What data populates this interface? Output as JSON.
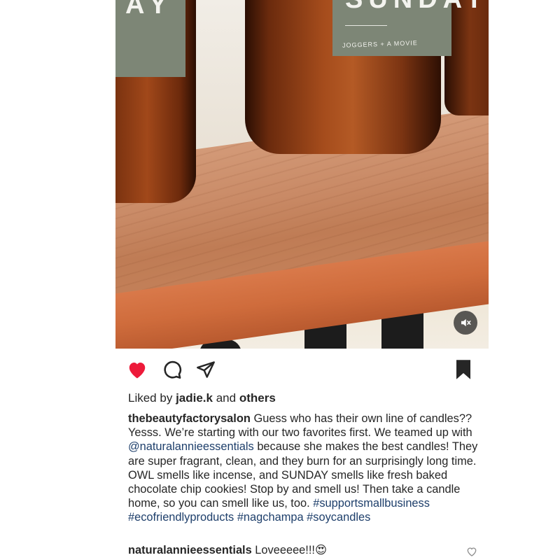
{
  "post": {
    "media": {
      "jar_left_label": "AY",
      "jar_mid_label": "SUNDAY",
      "jar_mid_sublabel": "JOGGERS + A MOVIE",
      "muted": true
    },
    "actions": {
      "liked": true,
      "saved": true,
      "like_color": "#ed1a3a"
    },
    "likes": {
      "prefix": "Liked by",
      "user": "jadie.k",
      "middle": "and",
      "others": "others"
    },
    "caption": {
      "user": "thebeautyfactorysalon",
      "text_1": "Guess who has their own line of candles?? Yesss.  We’re starting with our two favorites first. We teamed up with",
      "mention": "@naturalannieessentials",
      "text_2": "because she makes the best candles! They are super fragrant, clean, and they burn for an surprisingly long time. OWL smells like incense, and SUNDAY smells like fresh baked chocolate chip cookies! Stop by and smell us! Then take a candle home, so you can smell like us, too.",
      "hashtags": [
        "#supportsmallbusiness",
        "#ecofriendlyproducts",
        "#nagchampa",
        "#soycandles"
      ]
    },
    "comment": {
      "user": "naturalannieessentials",
      "text": "Loveeeee!!!",
      "emoji": "😍"
    }
  }
}
